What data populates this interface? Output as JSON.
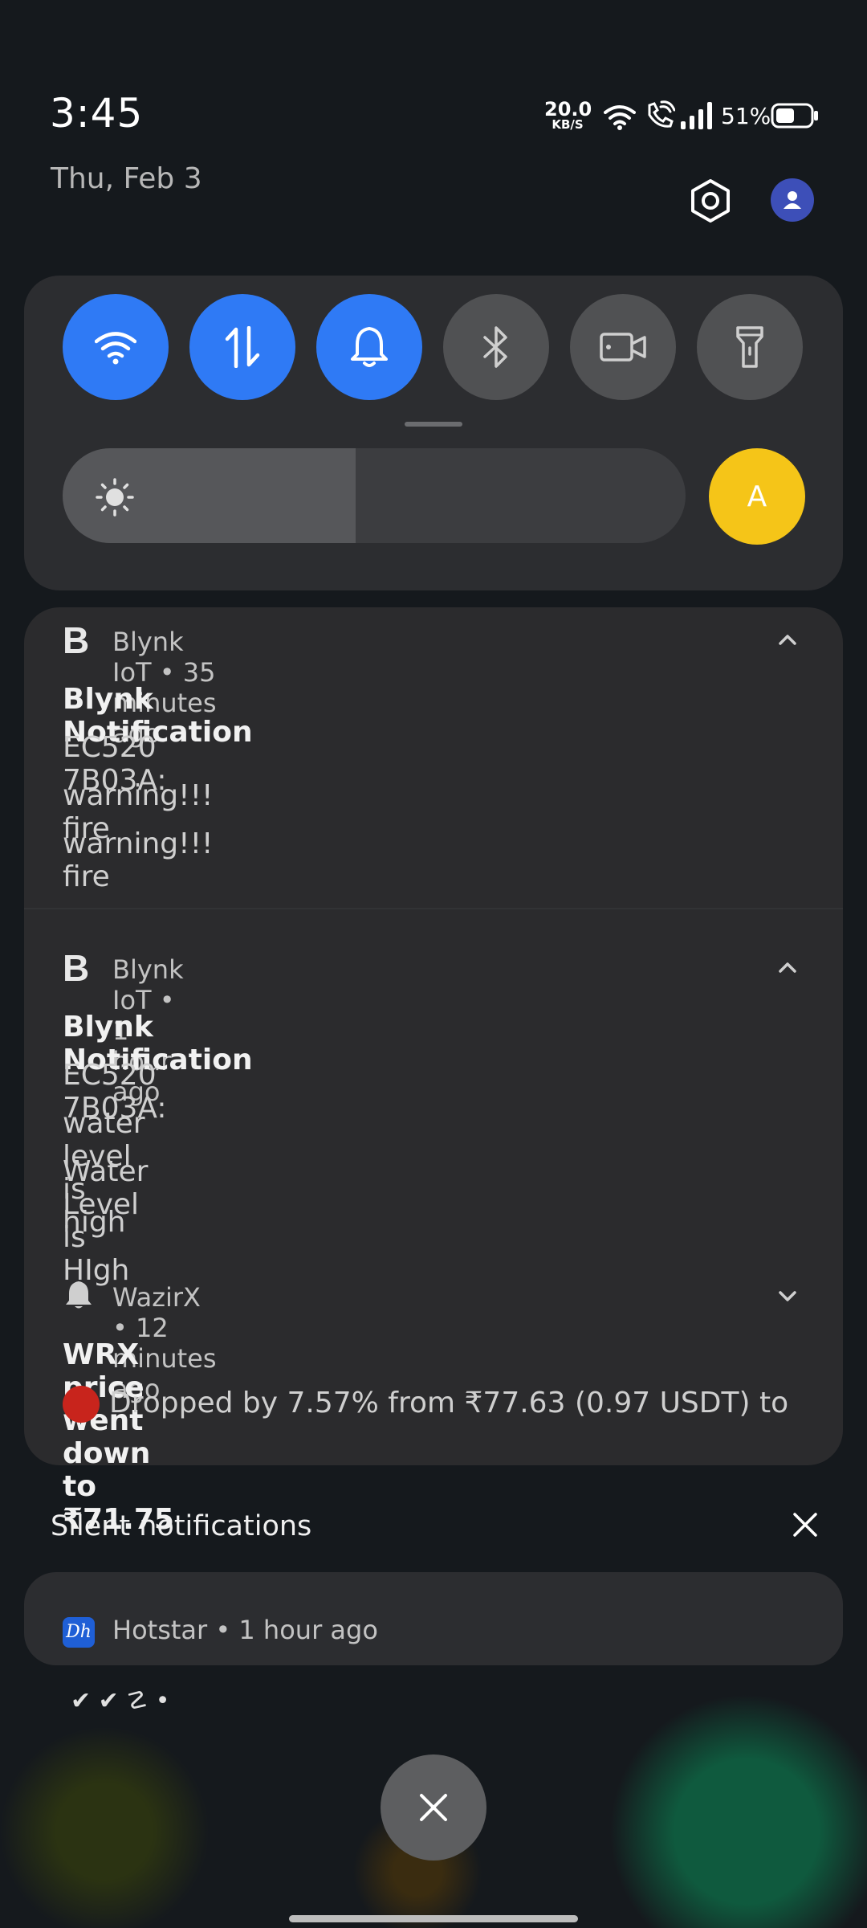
{
  "status_bar": {
    "time": "3:45",
    "date": "Thu, Feb 3",
    "net_speed_value": "20.0",
    "net_speed_unit": "KB/S",
    "battery_percent": "51%"
  },
  "quick_settings": {
    "tiles": [
      {
        "name": "wifi",
        "icon": "wifi-icon",
        "active": true
      },
      {
        "name": "mobile-data",
        "icon": "data-arrows-icon",
        "active": true
      },
      {
        "name": "sound",
        "icon": "bell-icon",
        "active": true
      },
      {
        "name": "bluetooth",
        "icon": "bluetooth-icon",
        "active": false
      },
      {
        "name": "screen-record",
        "icon": "screen-record-icon",
        "active": false
      },
      {
        "name": "flashlight",
        "icon": "flashlight-icon",
        "active": false
      }
    ],
    "brightness_level": 0.47,
    "auto_brightness_label": "A"
  },
  "notifications": [
    {
      "app_icon_letter": "B",
      "app_line": "Blynk IoT • 35 minutes ago",
      "title": "Blynk Notification",
      "lines": [
        "EC520 7B03A:",
        "warning!!! fire",
        "warning!!! fire"
      ],
      "expanded": true
    },
    {
      "app_icon_letter": "B",
      "app_line": "Blynk IoT • 1 hour ago",
      "title": "Blynk Notification",
      "lines": [
        "EC520 7B03A:",
        "water level is high",
        "Water Level is HIgh"
      ],
      "expanded": true
    },
    {
      "app_icon": "bell-icon",
      "app_line": "WazirX • 12 minutes ago",
      "title": "WRX price went down to ₹71.75",
      "lines": [
        "Dropped by 7.57% from ₹77.63 (0.97 USDT) to ₹.."
      ],
      "expanded": false
    }
  ],
  "silent": {
    "title": "Silent notifications",
    "hotstar_icon_text": "Dh",
    "hotstar_app_line": "Hotstar • 1 hour ago",
    "mini_icons": "✔ ✔ ☡ •"
  },
  "colors": {
    "accent": "#2f7af5",
    "auto_brightness": "#f5c518",
    "alert_dot": "#c8241c",
    "avatar": "#3d4fb8"
  }
}
